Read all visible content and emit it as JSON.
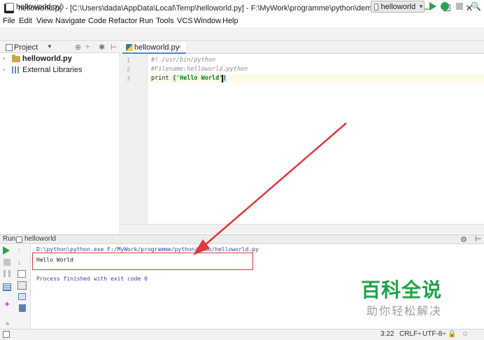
{
  "window": {
    "title": "helloworld.py - [C:\\Users\\dada\\AppData\\Local\\Temp\\helloworld.py] - F:\\MyWork\\programme\\python\\demo\\helloworld.py - PyC...",
    "minimize": "─",
    "maximize": "☐",
    "close": "✕"
  },
  "menu": [
    "File",
    "Edit",
    "View",
    "Navigate",
    "Code",
    "Refactor",
    "Run",
    "Tools",
    "VCS",
    "Window",
    "Help"
  ],
  "navbar": {
    "breadcrumb": "helloworld.py",
    "breadcrumb_chevron": "❯",
    "run_config": "helloworld",
    "search_glyph": "🔍"
  },
  "project": {
    "header": "Project",
    "header_chevron": "▼",
    "tools": [
      "⊕",
      "÷",
      "✱",
      "⊢"
    ],
    "tree": [
      {
        "arrow": "›",
        "label": "helloworld.py",
        "icon": "folder-icon"
      },
      {
        "arrow": "›",
        "label": "External Libraries",
        "icon": "libraries-icon"
      }
    ]
  },
  "editor": {
    "tab_label": "helloworld.py",
    "tab_close": "×",
    "line_numbers": [
      "1",
      "2",
      "3"
    ],
    "lines": [
      "#! /usr/bin/python",
      "#Filename:helloworld.python"
    ],
    "line3_keyword": "print ",
    "line3_open": "(",
    "line3_string": "'Hello World'",
    "line3_close": ")"
  },
  "run": {
    "header_label": "Run",
    "config": "helloworld",
    "gear": "⚙",
    "minimize": "⊢",
    "up": "↑",
    "down": "↓",
    "pin": "✦",
    "more": "»",
    "console": {
      "command": "D:\\python\\python.exe F:/MyWork/programme/python/demo/helloworld.py",
      "output": "Hello World",
      "exit": "Process finished with exit code 0"
    }
  },
  "watermark": {
    "main": "百科全说",
    "sub": "助你轻松解决"
  },
  "status": {
    "position": "3:22",
    "line_sep": "CRLF÷",
    "encoding": "UTF-8÷"
  },
  "colors": {
    "run_green": "#2aa44b",
    "annotation_red": "#e0393e",
    "watermark_green": "#1ea34a",
    "string_green": "#067d17"
  }
}
